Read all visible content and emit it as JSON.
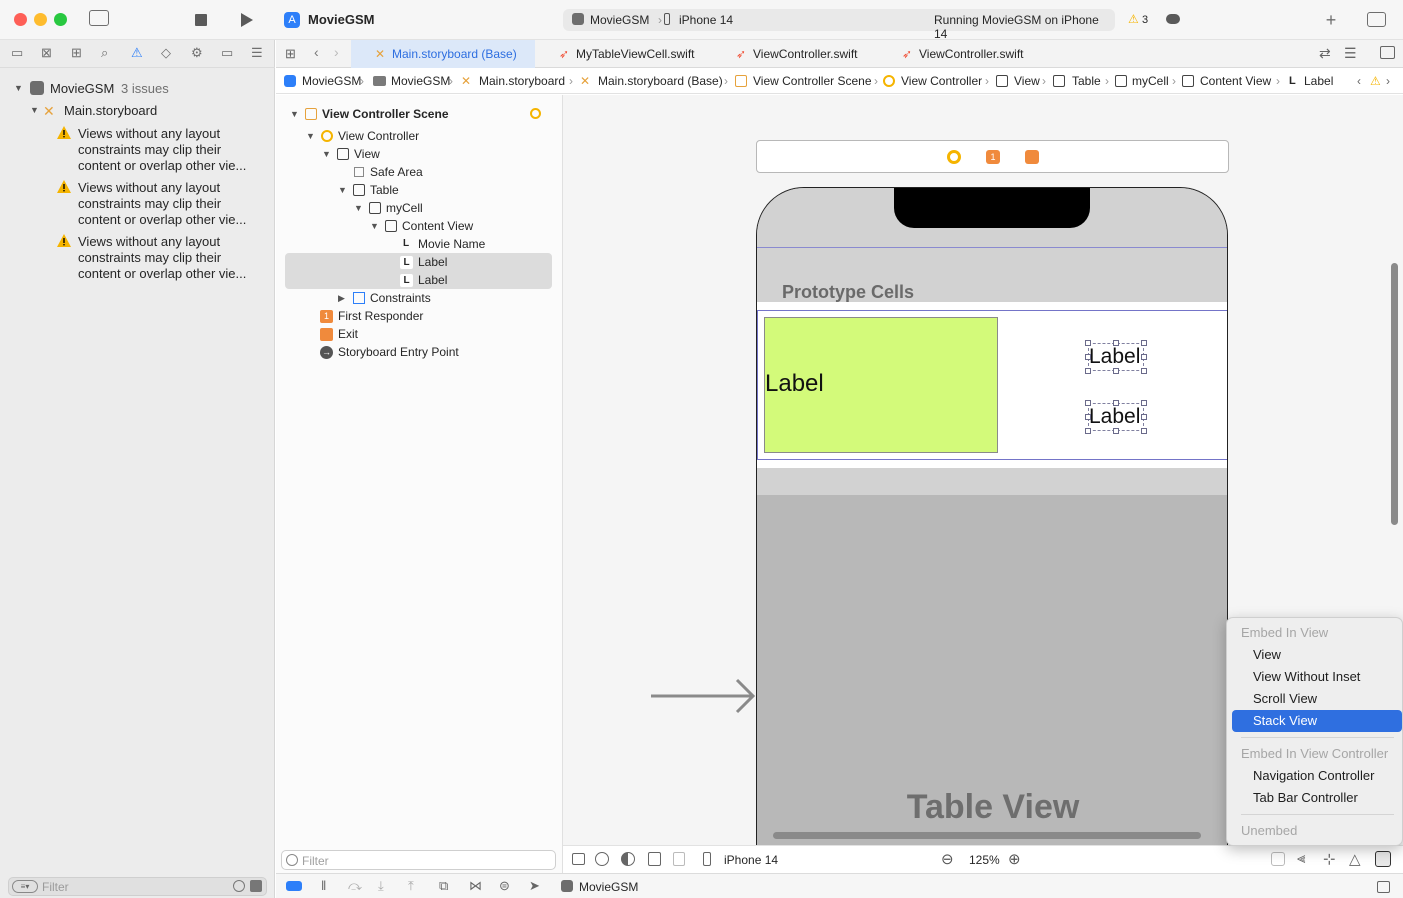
{
  "toolbar": {
    "project": "MovieGSM",
    "scheme_target": "MovieGSM",
    "device": "iPhone 14",
    "status": "Running MovieGSM on iPhone 14",
    "warning_count": "3"
  },
  "navigator": {
    "project_name": "MovieGSM",
    "issues_label": "3 issues",
    "file": "Main.storyboard",
    "issues": [
      {
        "line1": "Views without any layout",
        "line2": "constraints may clip their",
        "line3": "content or overlap other vie..."
      },
      {
        "line1": "Views without any layout",
        "line2": "constraints may clip their",
        "line3": "content or overlap other vie..."
      },
      {
        "line1": "Views without any layout",
        "line2": "constraints may clip their",
        "line3": "content or overlap other vie..."
      }
    ],
    "filter_placeholder": "Filter"
  },
  "tabs": [
    {
      "label": "Main.storyboard (Base)"
    },
    {
      "label": "MyTableViewCell.swift"
    },
    {
      "label": "ViewController.swift"
    },
    {
      "label": "ViewController.swift"
    }
  ],
  "jumpbar": [
    "MovieGSM",
    "MovieGSM",
    "Main.storyboard",
    "Main.storyboard (Base)",
    "View Controller Scene",
    "View Controller",
    "View",
    "Table",
    "myCell",
    "Content View",
    "Label"
  ],
  "outline": {
    "scene": "View Controller Scene",
    "items": [
      {
        "label": "View Controller"
      },
      {
        "label": "View"
      },
      {
        "label": "Safe Area"
      },
      {
        "label": "Table"
      },
      {
        "label": "myCell"
      },
      {
        "label": "Content View"
      },
      {
        "label": "Movie Name"
      },
      {
        "label": "Label"
      },
      {
        "label": "Label"
      },
      {
        "label": "Constraints"
      },
      {
        "label": "First Responder"
      },
      {
        "label": "Exit"
      },
      {
        "label": "Storyboard Entry Point"
      }
    ],
    "filter_placeholder": "Filter"
  },
  "canvas": {
    "prototype_cells": "Prototype Cells",
    "cell_label_big": "Label",
    "cell_label_a": "Label",
    "cell_label_b": "Label",
    "table_view": "Table View"
  },
  "bottombar": {
    "device": "iPhone 14",
    "zoom": "125%"
  },
  "statusbar": {
    "target": "MovieGSM"
  },
  "menu": {
    "header1": "Embed In View",
    "items1": [
      "View",
      "View Without Inset",
      "Scroll View",
      "Stack View"
    ],
    "header2": "Embed In View Controller",
    "items2": [
      "Navigation Controller",
      "Tab Bar Controller"
    ],
    "footer": "Unembed"
  },
  "colors": {
    "accent": "#2f6fe0",
    "cell_green": "#d3fa7a",
    "warning": "#f5b400"
  }
}
